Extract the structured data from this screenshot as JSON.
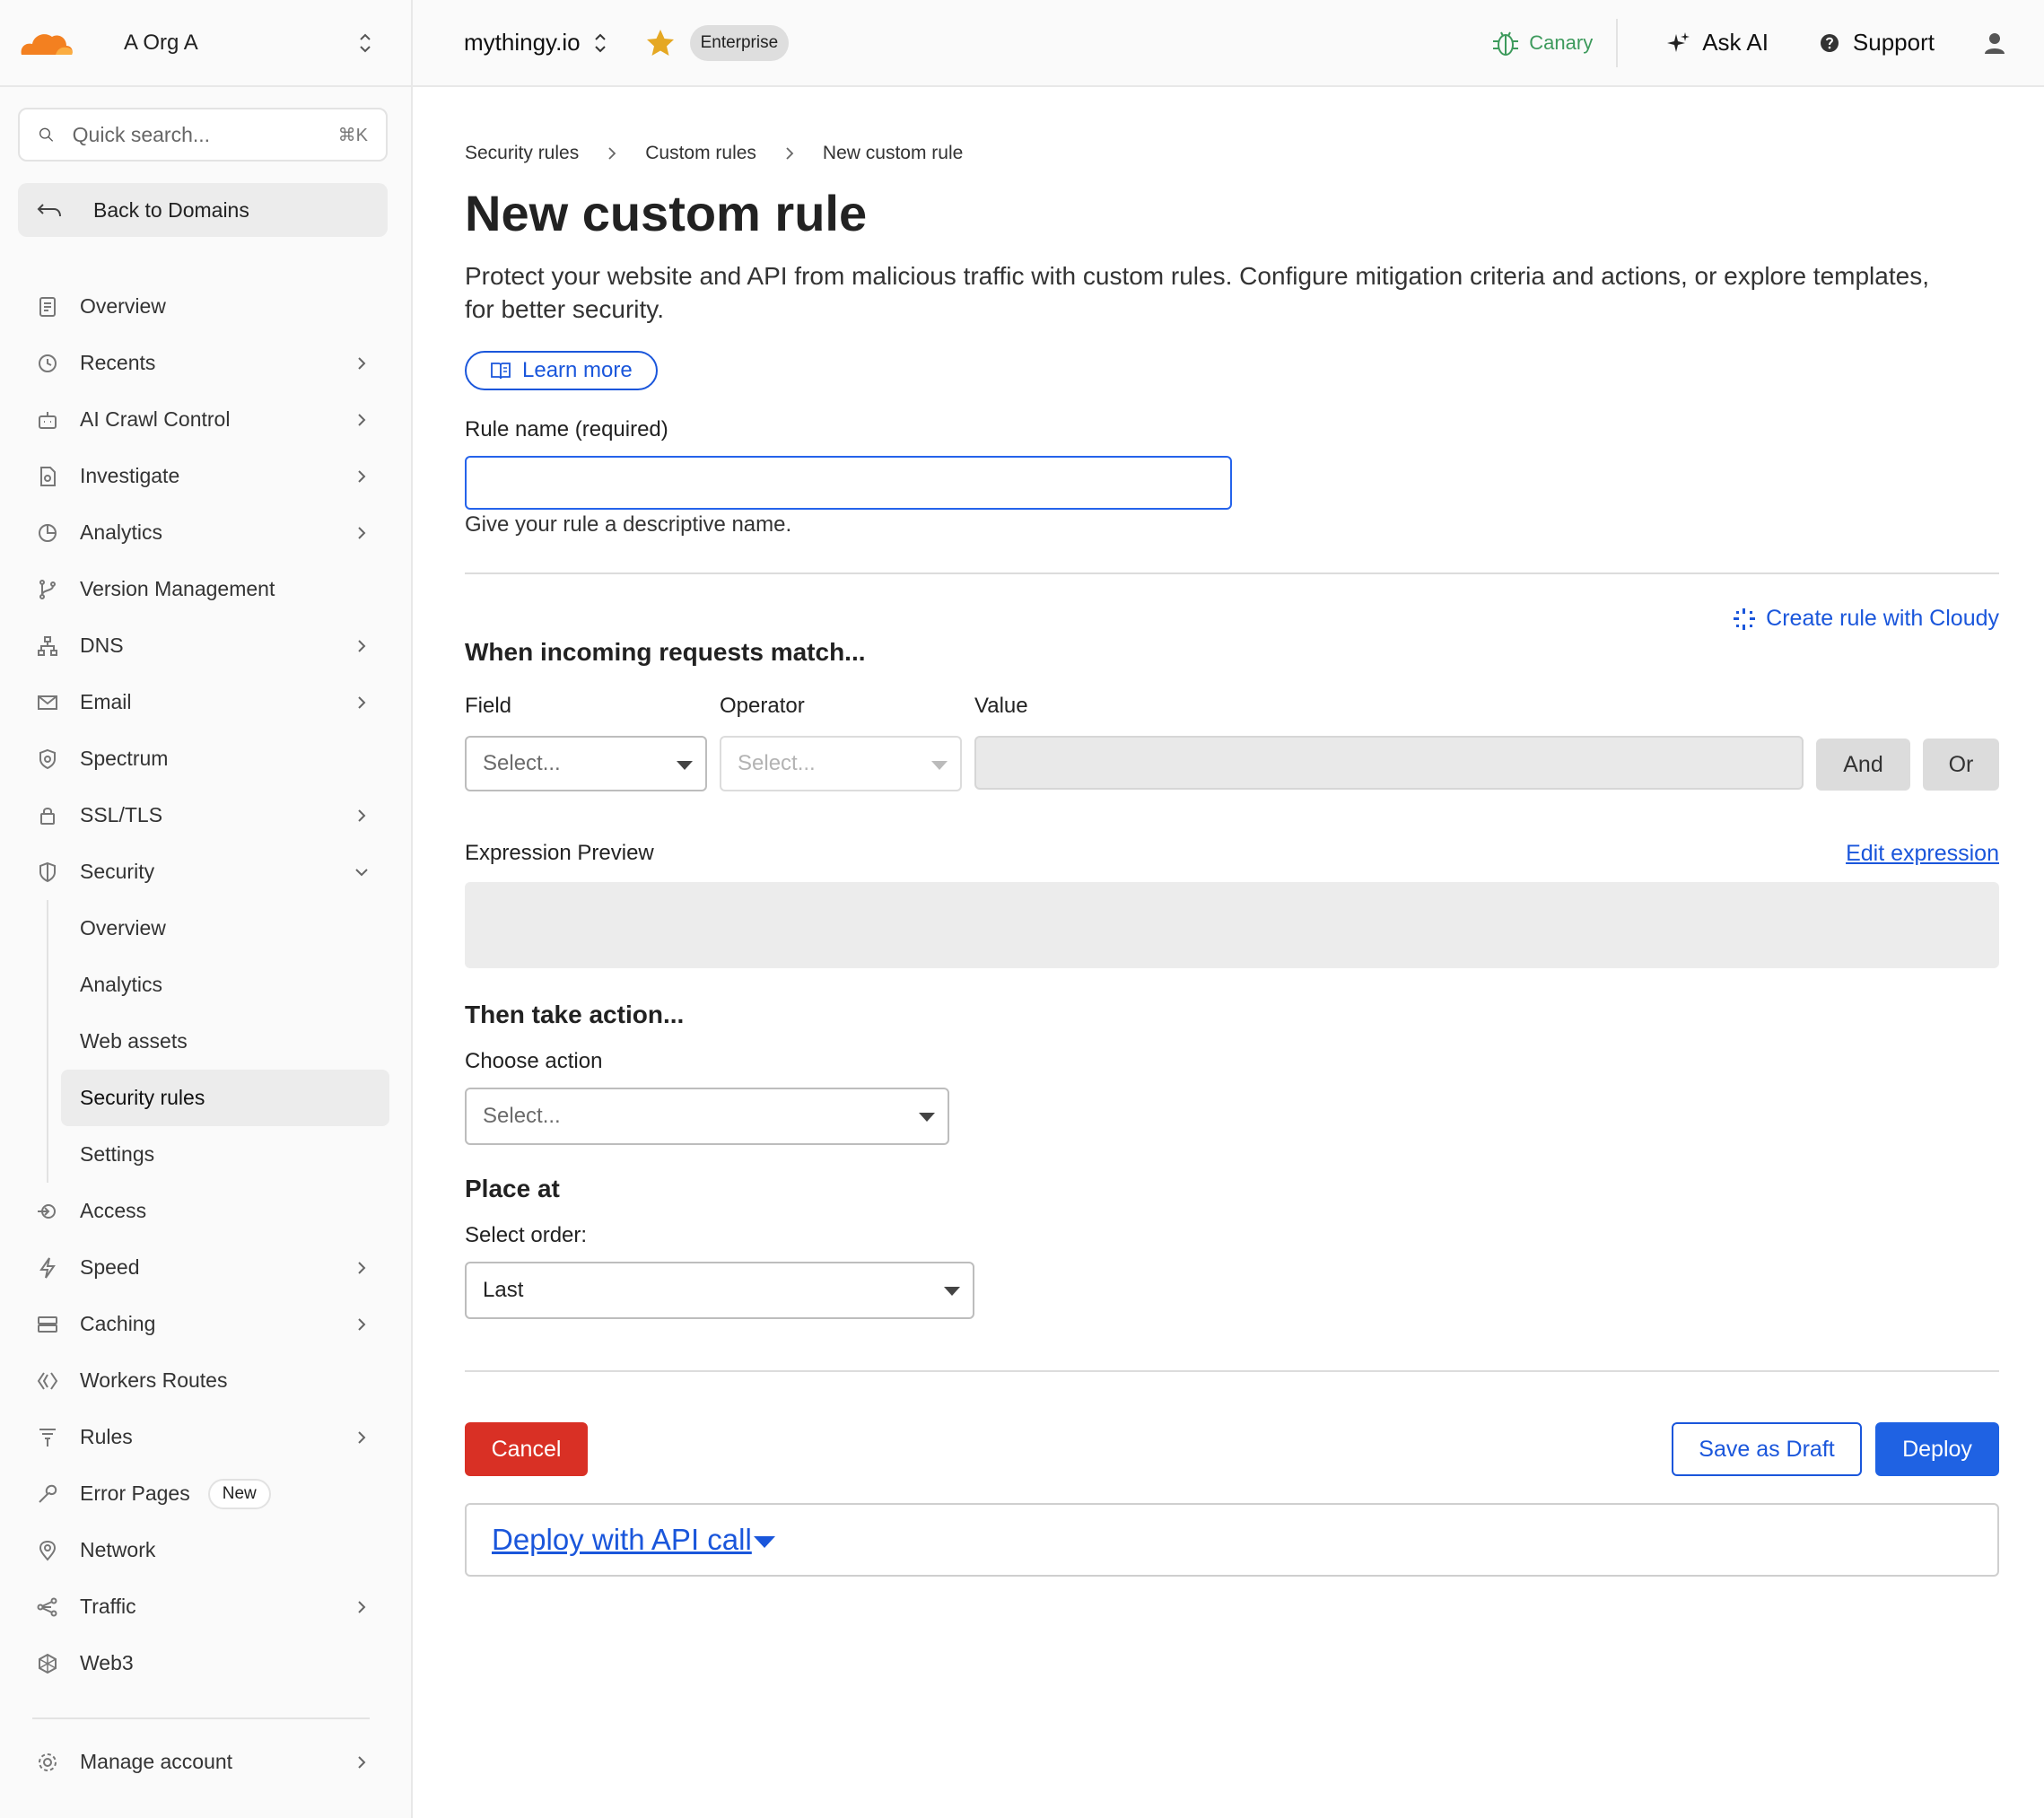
{
  "org": {
    "name": "A Org A"
  },
  "search": {
    "placeholder": "Quick search...",
    "shortcut": "⌘K"
  },
  "back": {
    "label": "Back to Domains"
  },
  "nav": {
    "overview": "Overview",
    "recents": "Recents",
    "ai_crawl": "AI Crawl Control",
    "investigate": "Investigate",
    "analytics": "Analytics",
    "version": "Version Management",
    "dns": "DNS",
    "email": "Email",
    "spectrum": "Spectrum",
    "ssl": "SSL/TLS",
    "security": "Security",
    "security_sub": [
      "Overview",
      "Analytics",
      "Web assets",
      "Security rules",
      "Settings"
    ],
    "access": "Access",
    "speed": "Speed",
    "caching": "Caching",
    "workers": "Workers Routes",
    "rules": "Rules",
    "error_pages": "Error Pages",
    "error_pages_badge": "New",
    "network": "Network",
    "traffic": "Traffic",
    "web3": "Web3",
    "manage": "Manage account"
  },
  "topbar": {
    "domain": "mythingy.io",
    "plan": "Enterprise",
    "canary": "Canary",
    "ask_ai": "Ask AI",
    "support": "Support"
  },
  "breadcrumb": [
    "Security rules",
    "Custom rules",
    "New custom rule"
  ],
  "page": {
    "title": "New custom rule",
    "description": "Protect your website and API from malicious traffic with custom rules. Configure mitigation criteria and actions, or explore templates, for better security.",
    "learn_more": "Learn more"
  },
  "rule_name": {
    "label": "Rule name (required)",
    "value": "",
    "help": "Give your rule a descriptive name."
  },
  "match": {
    "cloudy": "Create rule with Cloudy",
    "heading": "When incoming requests match...",
    "field_label": "Field",
    "operator_label": "Operator",
    "value_label": "Value",
    "field_value": "Select...",
    "operator_value": "Select...",
    "and": "And",
    "or": "Or"
  },
  "expression": {
    "label": "Expression Preview",
    "edit": "Edit expression"
  },
  "action": {
    "heading": "Then take action...",
    "choose_label": "Choose action",
    "choose_value": "Select..."
  },
  "place": {
    "heading": "Place at",
    "order_label": "Select order:",
    "order_value": "Last"
  },
  "buttons": {
    "cancel": "Cancel",
    "save_draft": "Save as Draft",
    "deploy": "Deploy"
  },
  "api": {
    "label": "Deploy with API call"
  },
  "colors": {
    "accent": "#1a56db",
    "danger": "#d93025",
    "canary": "#3d9a5c",
    "logo": "#f38020",
    "star": "#e5a823"
  }
}
